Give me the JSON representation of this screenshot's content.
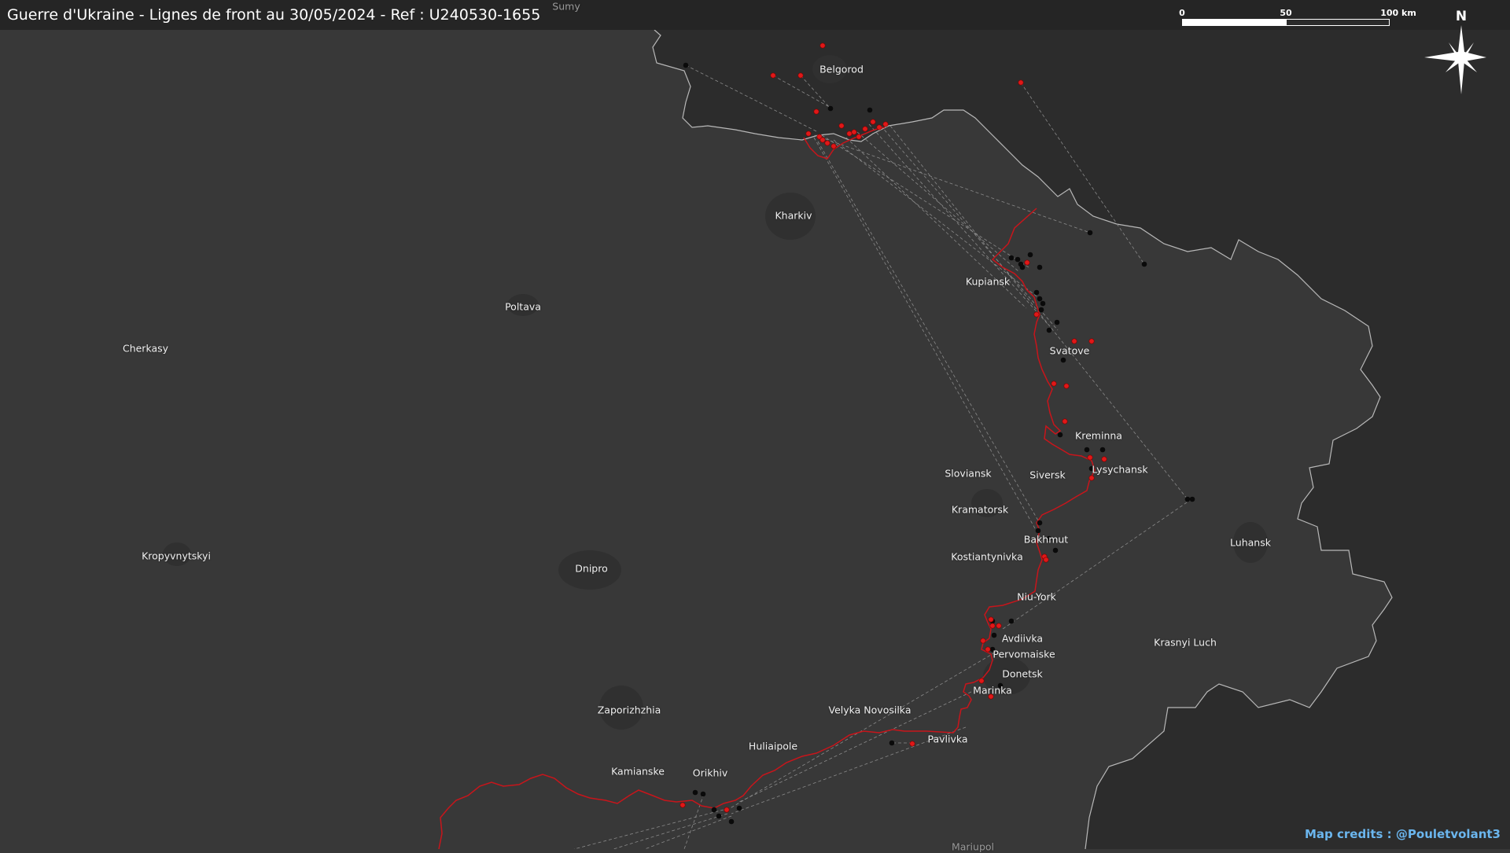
{
  "map": {
    "title": "Guerre d'Ukraine - Lignes de front au 30/05/2024 - Ref : U240530-1655",
    "credits": "Map credits : @Pouletvolant3",
    "colors": {
      "background": "#383838",
      "russia_land": "#2c2c2c",
      "border": "#b8b8b8",
      "front_line": "#c8151b",
      "ukr_marker": "#0a0a0a",
      "rus_marker": "#e01818",
      "city_area": "#303030",
      "connector": "#8a8a8a",
      "credits": "#6bb6ee"
    },
    "scale": {
      "ticks": [
        "0",
        "50",
        "100 km"
      ]
    },
    "compass": {
      "label": "N",
      "icon": "north-arrow-icon"
    },
    "cities": [
      {
        "id": "sumy",
        "name": "Sumy",
        "dim": true
      },
      {
        "id": "belgorod",
        "name": "Belgorod"
      },
      {
        "id": "kharkiv",
        "name": "Kharkiv"
      },
      {
        "id": "kupiansk",
        "name": "Kupiansk"
      },
      {
        "id": "poltava",
        "name": "Poltava"
      },
      {
        "id": "cherkasy",
        "name": "Cherkasy"
      },
      {
        "id": "svatove",
        "name": "Svatove"
      },
      {
        "id": "kreminna",
        "name": "Kreminna"
      },
      {
        "id": "lysychansk",
        "name": "Lysychansk"
      },
      {
        "id": "sloviansk",
        "name": "Sloviansk"
      },
      {
        "id": "siversk",
        "name": "Siversk"
      },
      {
        "id": "kramatorsk",
        "name": "Kramatorsk"
      },
      {
        "id": "bakhmut",
        "name": "Bakhmut"
      },
      {
        "id": "kostiantynivka",
        "name": "Kostiantynivka"
      },
      {
        "id": "kropyvnytskyi",
        "name": "Kropyvnytskyi"
      },
      {
        "id": "dnipro",
        "name": "Dnipro"
      },
      {
        "id": "luhansk",
        "name": "Luhansk"
      },
      {
        "id": "niu-york",
        "name": "Niu-York"
      },
      {
        "id": "avdiivka",
        "name": "Avdiivka"
      },
      {
        "id": "pervomaiske",
        "name": "Pervomaiske"
      },
      {
        "id": "krasnyi-luch",
        "name": "Krasnyi Luch"
      },
      {
        "id": "donetsk",
        "name": "Donetsk"
      },
      {
        "id": "marinka",
        "name": "Marinka"
      },
      {
        "id": "zaporizhzhia",
        "name": "Zaporizhzhia"
      },
      {
        "id": "velyka-novosilka",
        "name": "Velyka Novosilka"
      },
      {
        "id": "pavlivka",
        "name": "Pavlivka"
      },
      {
        "id": "huliaipole",
        "name": "Huliaipole"
      },
      {
        "id": "kamianske",
        "name": "Kamianske"
      },
      {
        "id": "orikhiv",
        "name": "Orikhiv"
      },
      {
        "id": "mariupol",
        "name": "Mariupol",
        "dim": true
      }
    ]
  }
}
